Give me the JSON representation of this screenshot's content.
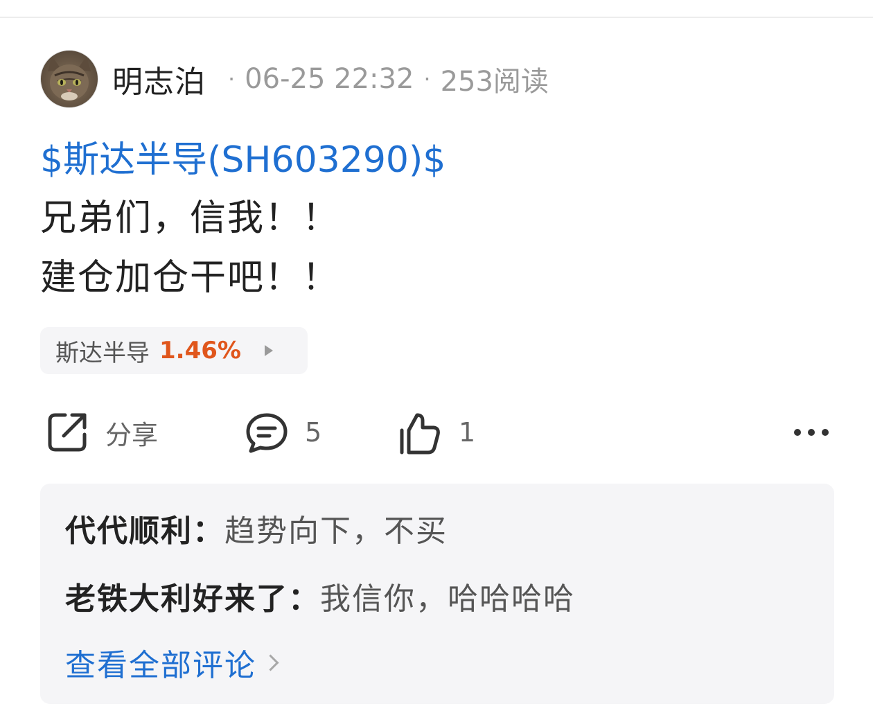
{
  "post": {
    "author": "明志泊",
    "date": "06-25 22:32",
    "reads": "253阅读",
    "dot": "·",
    "stock_link": "$斯达半导(SH603290)$",
    "lines": [
      "兄弟们，信我！！",
      "建仓加仓干吧！！"
    ]
  },
  "stock_chip": {
    "name": "斯达半导",
    "change": "1.46%",
    "change_color": "#e0561c"
  },
  "actions": {
    "share_label": "分享",
    "comment_count": "5",
    "like_count": "1",
    "share_icon": "share-icon",
    "comment_icon": "comment-bubble-icon",
    "like_icon": "thumbs-up-icon",
    "more_icon": "more-dots-icon"
  },
  "comments": [
    {
      "user": "代代顺利",
      "text": "趋势向下，不买"
    },
    {
      "user": "老铁大利好来了",
      "text": "我信你，哈哈哈哈"
    }
  ],
  "comment_colon": "：",
  "view_all_label": "查看全部评论",
  "colors": {
    "link": "#1f6fd1",
    "text": "#222222",
    "muted": "#9a9a9a",
    "panel": "#f5f5f7"
  }
}
